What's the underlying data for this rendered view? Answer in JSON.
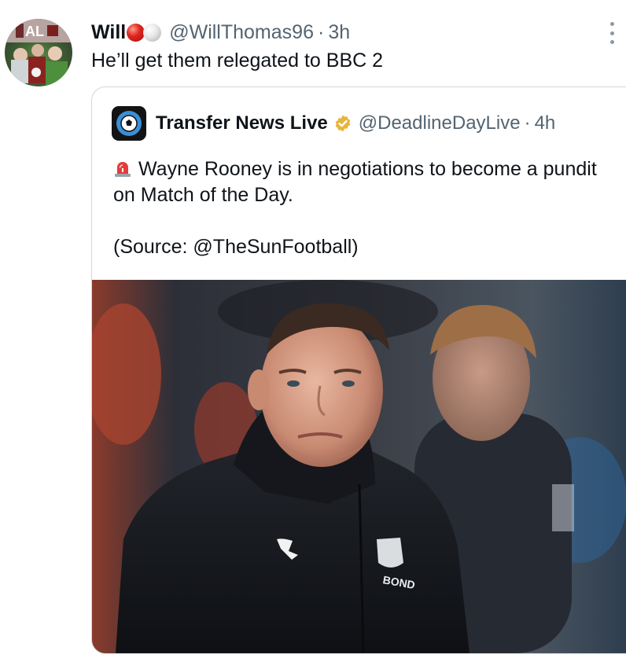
{
  "tweet": {
    "author_name": "Will",
    "author_handle": "@WillThomas96",
    "separator": "·",
    "time": "3h",
    "reply_text": "He’ll get them relegated to BBC 2",
    "more_icon": "more-options-icon"
  },
  "quoted_tweet": {
    "author_name": "Transfer News Live",
    "author_handle": "@DeadlineDayLive",
    "separator": "·",
    "time": "4h",
    "verified_color": "#e8b43a",
    "line1": "Wayne Rooney is in negotiations to become a pundit on Match of the Day.",
    "line2": "(Source: @TheSunFootball)",
    "leading_emoji": "siren-icon",
    "image": {
      "description_icon": "photo-football-manager",
      "crest_text": "BOND"
    }
  },
  "colors": {
    "text": "#0f1419",
    "secondary": "#536471",
    "border": "#cfd9de"
  }
}
